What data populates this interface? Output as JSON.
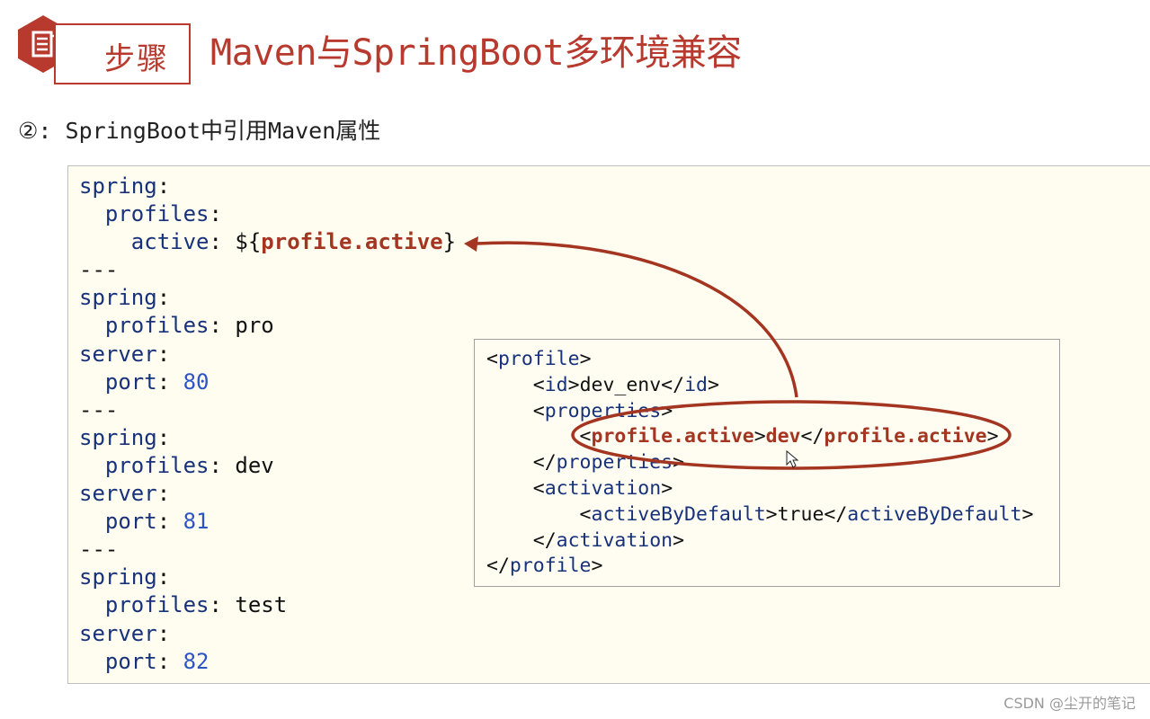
{
  "header": {
    "icon": "document-icon",
    "step_label": "步骤",
    "title": "Maven与SpringBoot多环境兼容"
  },
  "subtitle": "②: SpringBoot中引用Maven属性",
  "yaml_lines": [
    [
      {
        "c": "k",
        "t": "spring"
      },
      {
        "c": "",
        "t": ":"
      }
    ],
    [
      {
        "c": "",
        "t": "  "
      },
      {
        "c": "k",
        "t": "profiles"
      },
      {
        "c": "",
        "t": ":"
      }
    ],
    [
      {
        "c": "",
        "t": "    "
      },
      {
        "c": "k",
        "t": "active"
      },
      {
        "c": "",
        "t": ": ${"
      },
      {
        "c": "hl",
        "t": "profile.active"
      },
      {
        "c": "",
        "t": "}"
      }
    ],
    [
      {
        "c": "",
        "t": "---"
      }
    ],
    [
      {
        "c": "k",
        "t": "spring"
      },
      {
        "c": "",
        "t": ":"
      }
    ],
    [
      {
        "c": "",
        "t": "  "
      },
      {
        "c": "k",
        "t": "profiles"
      },
      {
        "c": "",
        "t": ": pro"
      }
    ],
    [
      {
        "c": "k",
        "t": "server"
      },
      {
        "c": "",
        "t": ":"
      }
    ],
    [
      {
        "c": "",
        "t": "  "
      },
      {
        "c": "k",
        "t": "port"
      },
      {
        "c": "",
        "t": ": "
      },
      {
        "c": "n",
        "t": "80"
      }
    ],
    [
      {
        "c": "",
        "t": "---"
      }
    ],
    [
      {
        "c": "k",
        "t": "spring"
      },
      {
        "c": "",
        "t": ":"
      }
    ],
    [
      {
        "c": "",
        "t": "  "
      },
      {
        "c": "k",
        "t": "profiles"
      },
      {
        "c": "",
        "t": ": dev"
      }
    ],
    [
      {
        "c": "k",
        "t": "server"
      },
      {
        "c": "",
        "t": ":"
      }
    ],
    [
      {
        "c": "",
        "t": "  "
      },
      {
        "c": "k",
        "t": "port"
      },
      {
        "c": "",
        "t": ": "
      },
      {
        "c": "n",
        "t": "81"
      }
    ],
    [
      {
        "c": "",
        "t": "---"
      }
    ],
    [
      {
        "c": "k",
        "t": "spring"
      },
      {
        "c": "",
        "t": ":"
      }
    ],
    [
      {
        "c": "",
        "t": "  "
      },
      {
        "c": "k",
        "t": "profiles"
      },
      {
        "c": "",
        "t": ": test"
      }
    ],
    [
      {
        "c": "k",
        "t": "server"
      },
      {
        "c": "",
        "t": ":"
      }
    ],
    [
      {
        "c": "",
        "t": "  "
      },
      {
        "c": "k",
        "t": "port"
      },
      {
        "c": "",
        "t": ": "
      },
      {
        "c": "n",
        "t": "82"
      }
    ]
  ],
  "xml_lines": [
    [
      {
        "c": "",
        "t": "<"
      },
      {
        "c": "t",
        "t": "profile"
      },
      {
        "c": "",
        "t": ">"
      }
    ],
    [
      {
        "c": "",
        "t": "    <"
      },
      {
        "c": "t",
        "t": "id"
      },
      {
        "c": "",
        "t": ">dev_env</"
      },
      {
        "c": "t",
        "t": "id"
      },
      {
        "c": "",
        "t": ">"
      }
    ],
    [
      {
        "c": "",
        "t": "    <"
      },
      {
        "c": "t",
        "t": "properties"
      },
      {
        "c": "",
        "t": ">"
      }
    ],
    [
      {
        "c": "",
        "t": "        <"
      },
      {
        "c": "th",
        "t": "profile.active"
      },
      {
        "c": "",
        "t": ">"
      },
      {
        "c": "th",
        "t": "dev"
      },
      {
        "c": "",
        "t": "</"
      },
      {
        "c": "th",
        "t": "profile.active"
      },
      {
        "c": "",
        "t": ">"
      }
    ],
    [
      {
        "c": "",
        "t": "    </"
      },
      {
        "c": "t",
        "t": "properties"
      },
      {
        "c": "",
        "t": ">"
      }
    ],
    [
      {
        "c": "",
        "t": "    <"
      },
      {
        "c": "t",
        "t": "activation"
      },
      {
        "c": "",
        "t": ">"
      }
    ],
    [
      {
        "c": "",
        "t": "        <"
      },
      {
        "c": "t",
        "t": "activeByDefault"
      },
      {
        "c": "",
        "t": ">true</"
      },
      {
        "c": "t",
        "t": "activeByDefault"
      },
      {
        "c": "",
        "t": ">"
      }
    ],
    [
      {
        "c": "",
        "t": "    </"
      },
      {
        "c": "t",
        "t": "activation"
      },
      {
        "c": "",
        "t": ">"
      }
    ],
    [
      {
        "c": "",
        "t": "</"
      },
      {
        "c": "t",
        "t": "profile"
      },
      {
        "c": "",
        "t": ">"
      }
    ]
  ],
  "colors": {
    "accent": "#b83a2e",
    "key": "#17327a",
    "number": "#2b55c4",
    "highlight": "#a33521",
    "code_bg": "#fffdf0"
  },
  "watermark": "CSDN @尘开的笔记"
}
